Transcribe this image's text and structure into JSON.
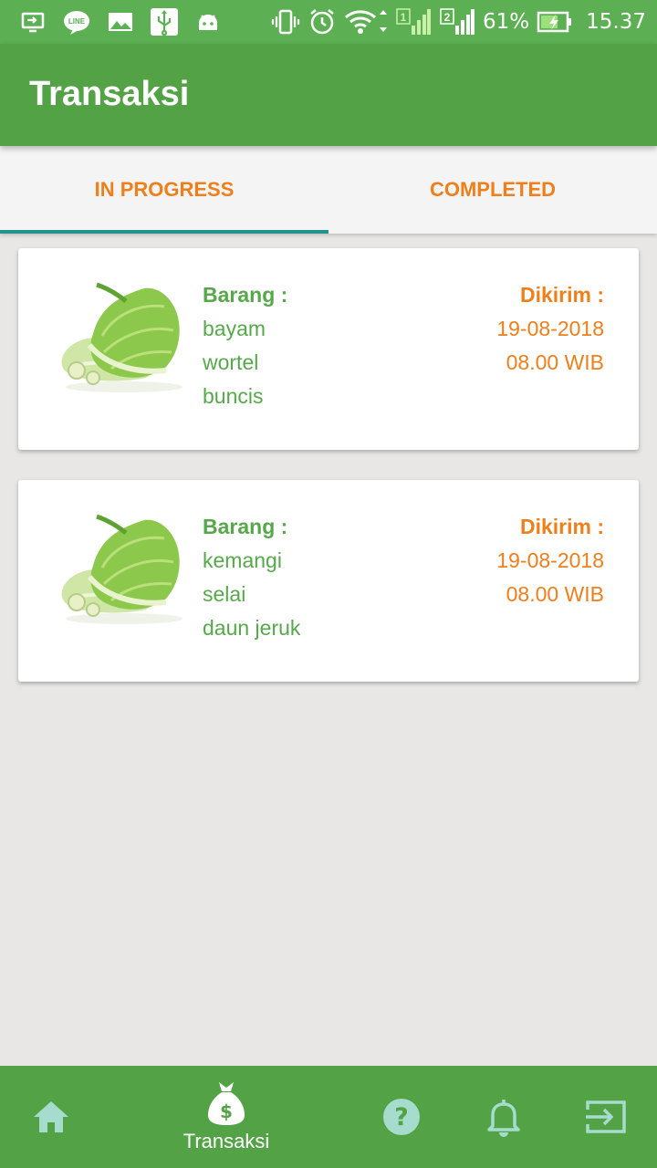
{
  "status_bar": {
    "battery": "61%",
    "time": "15.37",
    "icons": [
      "screen-cast-icon",
      "line-app-icon",
      "image-icon",
      "usb-icon",
      "android-icon",
      "vibrate-icon",
      "alarm-icon",
      "wifi-icon",
      "signal-sim1-icon",
      "signal-sim2-icon",
      "battery-charging-icon"
    ]
  },
  "app_bar": {
    "title": "Transaksi"
  },
  "tabs": [
    {
      "label": "IN PROGRESS",
      "active": true
    },
    {
      "label": "COMPLETED",
      "active": false
    }
  ],
  "orders": [
    {
      "image": "lettuce-image",
      "items_label": "Barang :",
      "items": [
        "bayam",
        "wortel",
        "buncis"
      ],
      "ship_label": "Dikirim :",
      "date": "19-08-2018",
      "time": "08.00 WIB"
    },
    {
      "image": "lettuce-image",
      "items_label": "Barang :",
      "items": [
        "kemangi",
        "selai",
        "daun jeruk"
      ],
      "ship_label": "Dikirim :",
      "date": "19-08-2018",
      "time": "08.00 WIB"
    }
  ],
  "bottom_nav": {
    "items": [
      {
        "icon": "home-icon",
        "label": ""
      },
      {
        "icon": "money-bag-icon",
        "label": "Transaksi",
        "active": true
      },
      {
        "icon": "help-icon",
        "label": ""
      },
      {
        "icon": "bell-icon",
        "label": ""
      },
      {
        "icon": "logout-icon",
        "label": ""
      }
    ]
  },
  "colors": {
    "status_bar": "#5cb053",
    "primary": "#54a246",
    "accent_orange": "#ee7f1b",
    "item_green": "#57a84b",
    "tab_indicator": "#20958d",
    "background": "#e8e7e5"
  }
}
